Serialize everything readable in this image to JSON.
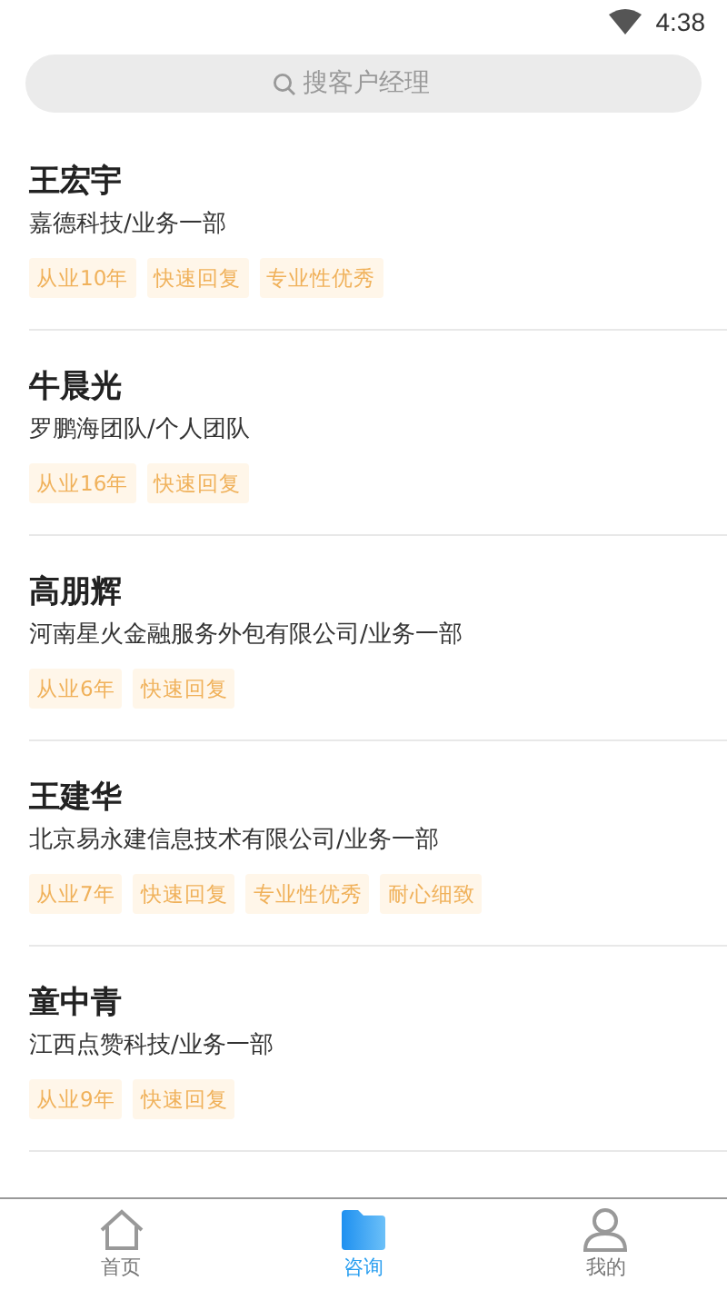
{
  "status_bar": {
    "time": "4:38"
  },
  "search": {
    "placeholder": "搜客户经理"
  },
  "managers": [
    {
      "name": "王宏宇",
      "company": "嘉德科技/业务一部",
      "tags": [
        "从业10年",
        "快速回复",
        "专业性优秀"
      ]
    },
    {
      "name": "牛晨光",
      "company": "罗鹏海团队/个人团队",
      "tags": [
        "从业16年",
        "快速回复"
      ]
    },
    {
      "name": "高朋辉",
      "company": "河南星火金融服务外包有限公司/业务一部",
      "tags": [
        "从业6年",
        "快速回复"
      ]
    },
    {
      "name": "王建华",
      "company": "北京易永建信息技术有限公司/业务一部",
      "tags": [
        "从业7年",
        "快速回复",
        "专业性优秀",
        "耐心细致"
      ]
    },
    {
      "name": "童中青",
      "company": "江西点赞科技/业务一部",
      "tags": [
        "从业9年",
        "快速回复"
      ]
    }
  ],
  "tab_bar": [
    {
      "kind": "home",
      "label": "首页",
      "selected": false
    },
    {
      "kind": "folder",
      "label": "咨询",
      "selected": true
    },
    {
      "kind": "person",
      "label": "我的",
      "selected": false
    }
  ]
}
